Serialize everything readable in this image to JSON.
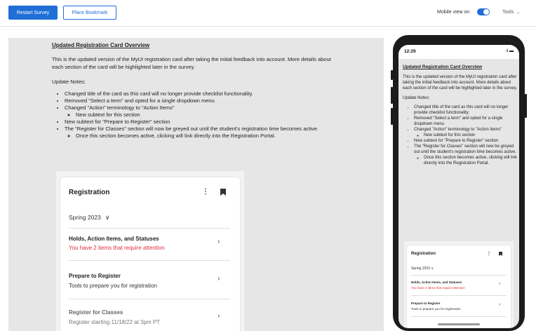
{
  "toolbar": {
    "restart_label": "Restart Survey",
    "bookmark_label": "Place Bookmark",
    "mobile_view_label": "Mobile view on",
    "tools_label": "Tools",
    "accent_color": "#1f6fd6"
  },
  "content": {
    "heading": "Updated Registration Card Overview",
    "intro": "This is the updated version of the MyUI registration card after taking the initial feedback into account. More details about each section of the card will be highlighted later in the survey.",
    "notes_title": "Update Notes:",
    "notes": [
      "Changed title of the card as this card will no longer provide checklist functionality.",
      "Removed \"Select a term\" and opted for a single dropdown menu",
      "Changed \"Action\" terminology to \"Action Items\"",
      "New subtext for this section",
      "New subtext for \"Prepare to Register\" section",
      "The \"Register for Classes\" section will now be greyed out until the student's registration time becomes active.",
      "Once this section becomes active, clicking will link directly into the Registration Portal."
    ]
  },
  "card": {
    "title": "Registration",
    "term": "Spring 2023",
    "rows": [
      {
        "title": "Holds, Action Items, and Statuses",
        "subtitle": "You have 2 items that require attention",
        "subtitle_color": "#e0303a"
      },
      {
        "title": "Prepare to Register",
        "subtitle": "Tools to prepare you for registration"
      },
      {
        "title": "Register for Classes",
        "subtitle": "Register starting 11/18/22 at 3pm PT"
      }
    ]
  },
  "phone": {
    "time": "12:29",
    "status_icons": "signal-battery-icon",
    "mobile_rows": [
      {
        "title": "Holds, Action Items, and Statuses",
        "subtitle": "You have 2 items that require attention"
      },
      {
        "title": "Prepare to Register",
        "subtitle": "Tools to prepare you for registration"
      }
    ]
  }
}
